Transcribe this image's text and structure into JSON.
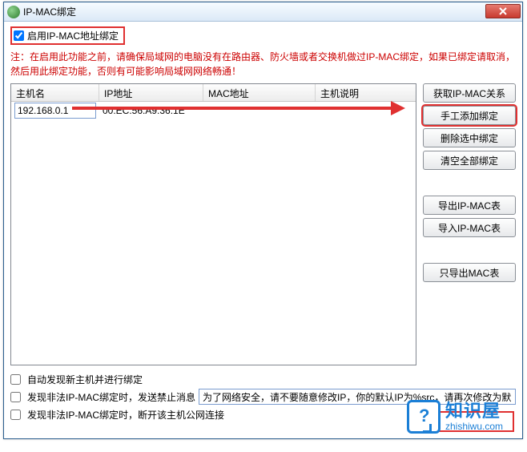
{
  "titlebar": {
    "title": "IP-MAC绑定"
  },
  "enable": {
    "label": "启用IP-MAC地址绑定",
    "checked": true
  },
  "note": "注：在启用此功能之前，请确保局域网的电脑没有在路由器、防火墙或者交换机做过IP-MAC绑定，如果已绑定请取消，然后用此绑定功能，否则有可能影响局域网网络畅通！",
  "table": {
    "headers": {
      "c1": "主机名",
      "c2": "IP地址",
      "c3": "MAC地址",
      "c4": "主机说明"
    },
    "row": {
      "host_value": "192.168.0.1",
      "ip": "00:EC:56:A9:36:1E",
      "mac": "",
      "desc": ""
    }
  },
  "buttons": {
    "get_rel": "获取IP-MAC关系",
    "manual_add": "手工添加绑定",
    "del_sel": "删除选中绑定",
    "clear_all": "清空全部绑定",
    "export_ipmac": "导出IP-MAC表",
    "import_ipmac": "导入IP-MAC表",
    "export_mac": "只导出MAC表"
  },
  "lower": {
    "auto_discover": {
      "label": "自动发现新主机并进行绑定",
      "checked": false
    },
    "illegal_msg": {
      "label": "发现非法IP-MAC绑定时，发送禁止消息",
      "checked": false,
      "value": "为了网络安全，请不要随意修改IP，你的默认IP为%src，请再次修改为默"
    },
    "illegal_disconnect": {
      "label": "发现非法IP-MAC绑定时，断开该主机公网连接",
      "checked": false
    }
  },
  "watermark": {
    "cn": "知识屋",
    "url": "zhishiwu.com"
  }
}
